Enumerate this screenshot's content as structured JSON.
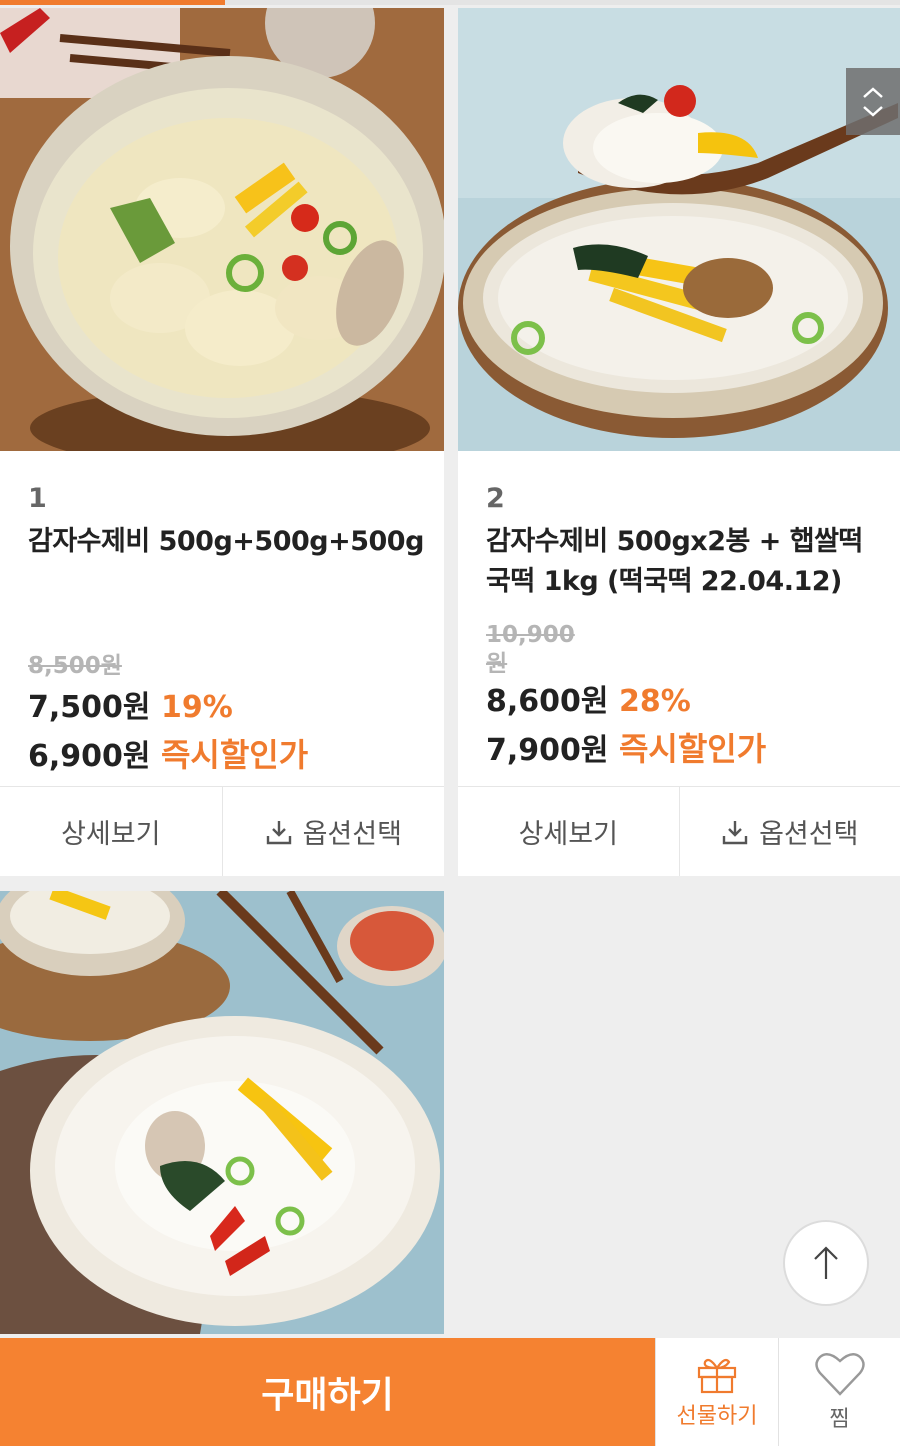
{
  "progress": {
    "value_percent": 25
  },
  "products": [
    {
      "rank": "1",
      "title": "감자수제비 500g+500g+500g",
      "title_line2": "",
      "original_price": "8,500원",
      "original_price_line2": "",
      "sale_price": "7,500원",
      "discount": "19%",
      "instant_price": "6,900원",
      "instant_label": "즉시할인가",
      "detail_label": "상세보기",
      "option_label": "옵션선택"
    },
    {
      "rank": "2",
      "title": "감자수제비 500gx2봉 + 햅쌀떡",
      "title_line2": "국떡 1kg (떡국떡 22.04.12)",
      "original_price": "10,900",
      "original_price_line2": "원",
      "sale_price": "8,600원",
      "discount": "28%",
      "instant_price": "7,900원",
      "instant_label": "즉시할인가",
      "detail_label": "상세보기",
      "option_label": "옵션선택"
    }
  ],
  "bottom_bar": {
    "buy_label": "구매하기",
    "gift_label": "선물하기",
    "wish_label": "찜"
  },
  "colors": {
    "accent": "#f07b2e",
    "buy_button": "#f58231"
  },
  "icons": [
    "download-icon",
    "gift-icon",
    "heart-icon",
    "arrow-up-icon",
    "chevron-up-icon",
    "chevron-down-icon"
  ]
}
